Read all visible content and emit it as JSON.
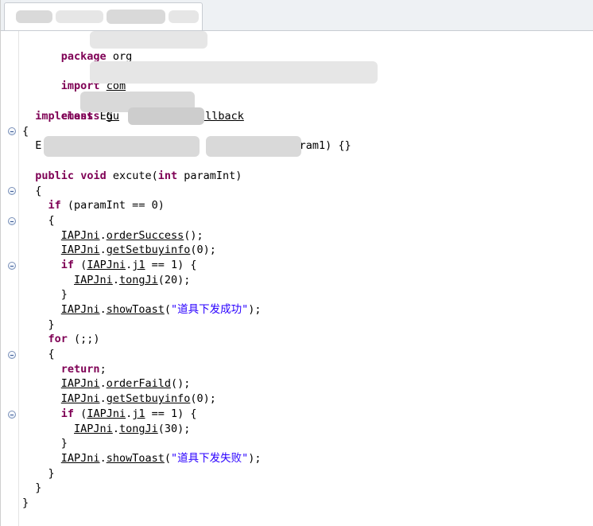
{
  "window": {
    "tab_title": ""
  },
  "code": {
    "pkg_kw": "package",
    "pkg_name": "org",
    "import_kw": "import",
    "import_name": "com",
    "class_kw": "class",
    "class_name": "Eg",
    "implements_kw": "implements",
    "iface_prefix": "Gu",
    "iface_suffix": "allback",
    "open_brace": "{",
    "ctor_prefix": "E",
    "ctor_mid": "g",
    "ctor_suffix": "aram1) {}",
    "method_kw1": "public",
    "method_kw2": "void",
    "method_name": " excute(",
    "param_kw": "int",
    "param_name": " paramInt)",
    "if_kw": "if",
    "if_cond": " (paramInt == 0)",
    "cls": "IAPJni",
    "dot": ".",
    "order_success": "orderSuccess",
    "order_faild": "orderFaild",
    "get_setbuy": "getSetbuyinfo",
    "tongji": "tongJi",
    "show_toast": "showToast",
    "field_j1": "j1",
    "call_end": "();",
    "arg_zero": "(0);",
    "if_open": " (",
    "cmp_one": " == 1) {",
    "arg_20": "(20);",
    "arg_30": "(30);",
    "toast_open": "(",
    "toast_success": "\"道具下发成功\"",
    "toast_fail": "\"道具下发失败\"",
    "toast_close": ");",
    "close_brace": "}",
    "for_kw": "for",
    "for_cond": " (;;)",
    "return_kw": "return",
    "semicolon": ";"
  }
}
